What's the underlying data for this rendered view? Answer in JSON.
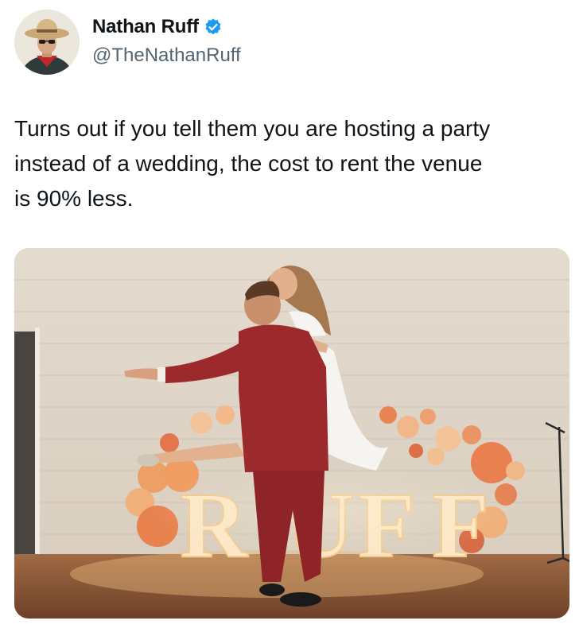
{
  "author": {
    "display_name": "Nathan Ruff",
    "handle": "@TheNathanRuff",
    "verified": true,
    "verified_color": "#1d9bf0",
    "avatar_icon": "cowboy-avatar-icon"
  },
  "tweet": {
    "text_lines": [
      "Turns out if you tell them you are hosting a party",
      "instead of a wedding, the cost to rent the venue",
      "is 90% less."
    ]
  },
  "media": {
    "marquee_letters": [
      "R",
      "U",
      "F",
      "F"
    ],
    "colors": {
      "suit": "#9c2a2d",
      "balloons": "#e59a62",
      "wall": "#e6ddd0",
      "floor": "#8a5a3a"
    }
  }
}
